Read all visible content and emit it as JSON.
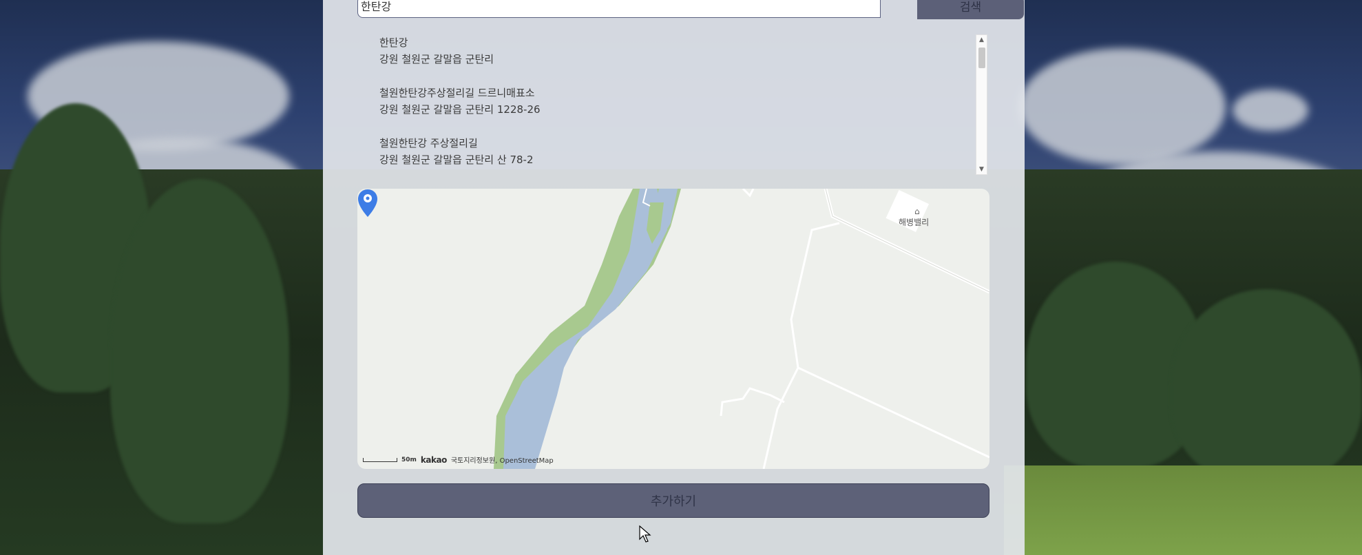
{
  "search": {
    "value": "한탄강",
    "button_label": "검색"
  },
  "results": [
    {
      "name": "한탄강",
      "address": "강원 철원군 갈말읍 군탄리"
    },
    {
      "name": "철원한탄강주상절리길 드르니매표소",
      "address": "강원 철원군 갈말읍 군탄리 1228-26"
    },
    {
      "name": "철원한탄강 주상절리길",
      "address": "강원 철원군 갈말읍 군탄리 산 78-2"
    }
  ],
  "map": {
    "poi_label": "해병밸리",
    "scale_label": "50m",
    "provider": "kakao",
    "attribution": "국토지리정보원, OpenStreetMap"
  },
  "add_button_label": "추가하기",
  "colors": {
    "panel": "#e2e5eb",
    "button": "#5d6178",
    "river": "#aabfd9",
    "riverbank": "#a8c98f",
    "pin": "#3d7de6"
  }
}
